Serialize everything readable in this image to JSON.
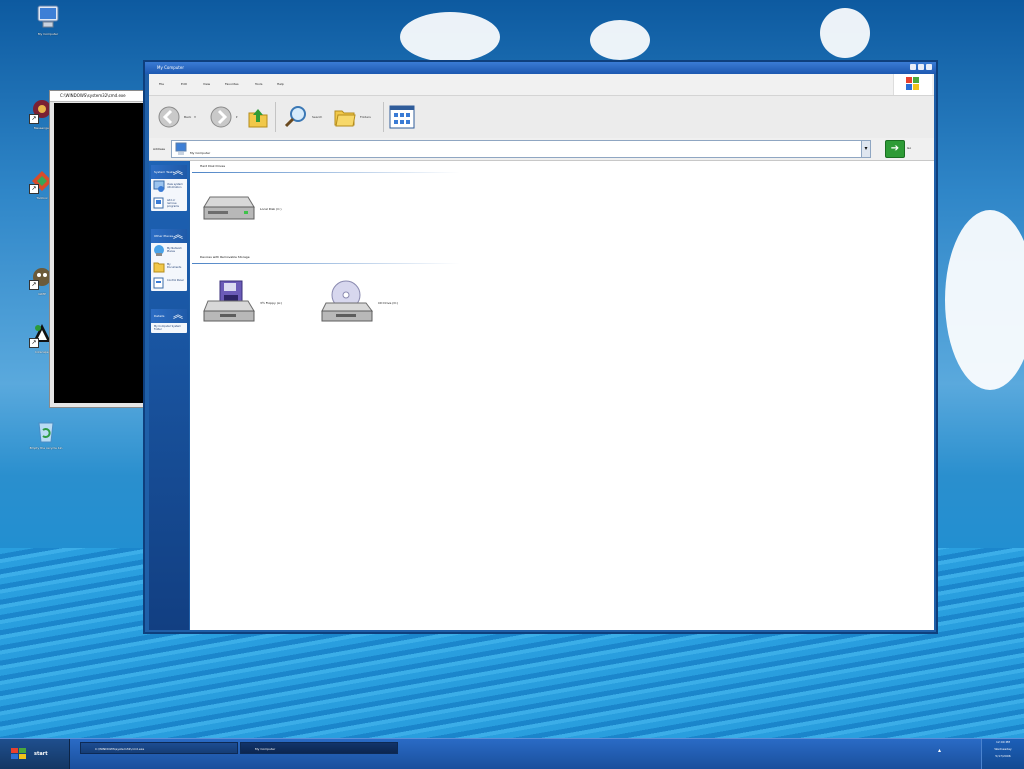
{
  "desktop": {
    "icons": [
      {
        "label": "My Computer"
      },
      {
        "label": "Messenger"
      },
      {
        "label": "Toolbox"
      },
      {
        "label": "GIMP"
      },
      {
        "label": "Inkscape"
      },
      {
        "label": "Empty the recycle bin"
      }
    ]
  },
  "console_window": {
    "title": "C:\\WINDOWS\\system32\\cmd.exe"
  },
  "window": {
    "title": "My Computer",
    "menu": [
      "File",
      "Edit",
      "View",
      "Favorites",
      "Tools",
      "Help"
    ],
    "toolbar": {
      "back_label": "Back",
      "search_label": "Search",
      "folders_label": "Folders"
    },
    "address": {
      "label": "Address",
      "value": "My Computer",
      "go_label": "Go"
    },
    "sidebar": {
      "panels": [
        {
          "title": "System Tasks",
          "items": [
            "View system information",
            "Add or remove programs"
          ]
        },
        {
          "title": "Other Places",
          "items": [
            "My Network Places",
            "My Documents",
            "Control Panel"
          ]
        },
        {
          "title": "Details",
          "items": [
            "My Computer System Folder"
          ]
        }
      ]
    },
    "groups": [
      {
        "title": "Hard Disk Drives",
        "items": [
          {
            "label": "Local Disk (C:)",
            "kind": "hard-disk"
          }
        ]
      },
      {
        "title": "Devices with Removable Storage",
        "items": [
          {
            "label": "3½ Floppy (A:)",
            "kind": "floppy"
          },
          {
            "label": "CD Drive (D:)",
            "kind": "cd"
          }
        ]
      }
    ]
  },
  "taskbar": {
    "start_label": "start",
    "tasks": [
      {
        "label": "C:\\WINDOWS\\system32\\cmd.exe"
      },
      {
        "label": "My Computer"
      }
    ],
    "clock": {
      "time": "12:00 PM",
      "day": "Wednesday",
      "date": "5/17/2006"
    }
  },
  "colors": {
    "titlebar": "#1d58b0",
    "sidebar": "#1e63b5",
    "go_button": "#2e9b36",
    "taskbar": "#1a4f9c"
  }
}
